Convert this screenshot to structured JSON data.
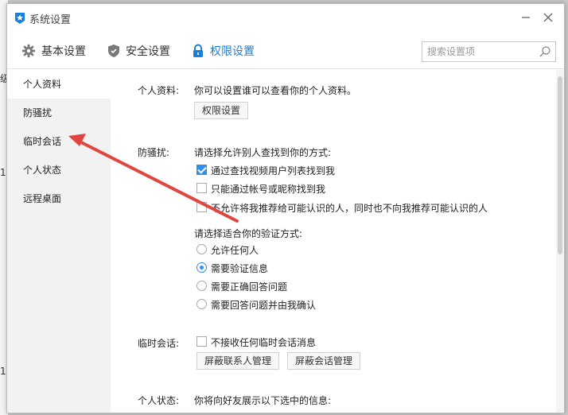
{
  "window": {
    "title": "系统设置"
  },
  "tabs": [
    {
      "label": "基本设置",
      "icon": "gear-icon"
    },
    {
      "label": "安全设置",
      "icon": "shield-icon"
    },
    {
      "label": "权限设置",
      "icon": "lock-icon",
      "active": true
    }
  ],
  "search": {
    "placeholder": "搜索设置项",
    "value": ""
  },
  "sidebar": {
    "items": [
      {
        "label": "个人资料",
        "active": true
      },
      {
        "label": "防骚扰"
      },
      {
        "label": "临时会话"
      },
      {
        "label": "个人状态"
      },
      {
        "label": "远程桌面"
      }
    ]
  },
  "profile": {
    "label": "个人资料:",
    "description": "你可以设置谁可以查看你的个人资料。",
    "button": "权限设置"
  },
  "anti_harass": {
    "label": "防骚扰:",
    "find_prompt": "请选择允许别人查找到你的方式:",
    "find_options": [
      {
        "label": "通过查找视频用户列表找到我",
        "checked": true
      },
      {
        "label": "只能通过帐号或昵称找到我",
        "checked": false
      },
      {
        "label": "不允许将我推荐给可能认识的人，同时也不向我推荐可能认识的人",
        "checked": false
      }
    ],
    "verify_prompt": "请选择适合你的验证方式:",
    "verify_options": [
      {
        "label": "允许任何人",
        "selected": false
      },
      {
        "label": "需要验证信息",
        "selected": true
      },
      {
        "label": "需要正确回答问题",
        "selected": false
      },
      {
        "label": "需要回答问题并由我确认",
        "selected": false
      }
    ]
  },
  "temp_chat": {
    "label": "临时会话:",
    "option": {
      "label": "不接收任何临时会话消息",
      "checked": false
    },
    "buttons": [
      "屏蔽联系人管理",
      "屏蔽会话管理"
    ]
  },
  "status": {
    "label": "个人状态:",
    "description": "你将向好友展示以下选中的信息:"
  },
  "background_window": {
    "glyphs": [
      "级",
      "1",
      "1"
    ]
  },
  "colors": {
    "accent": "#1a7fd6",
    "checkbox": "#2f8ff0",
    "annotation_arrow": "#e0463f",
    "sidebar_bg": "#f2f2f2"
  }
}
